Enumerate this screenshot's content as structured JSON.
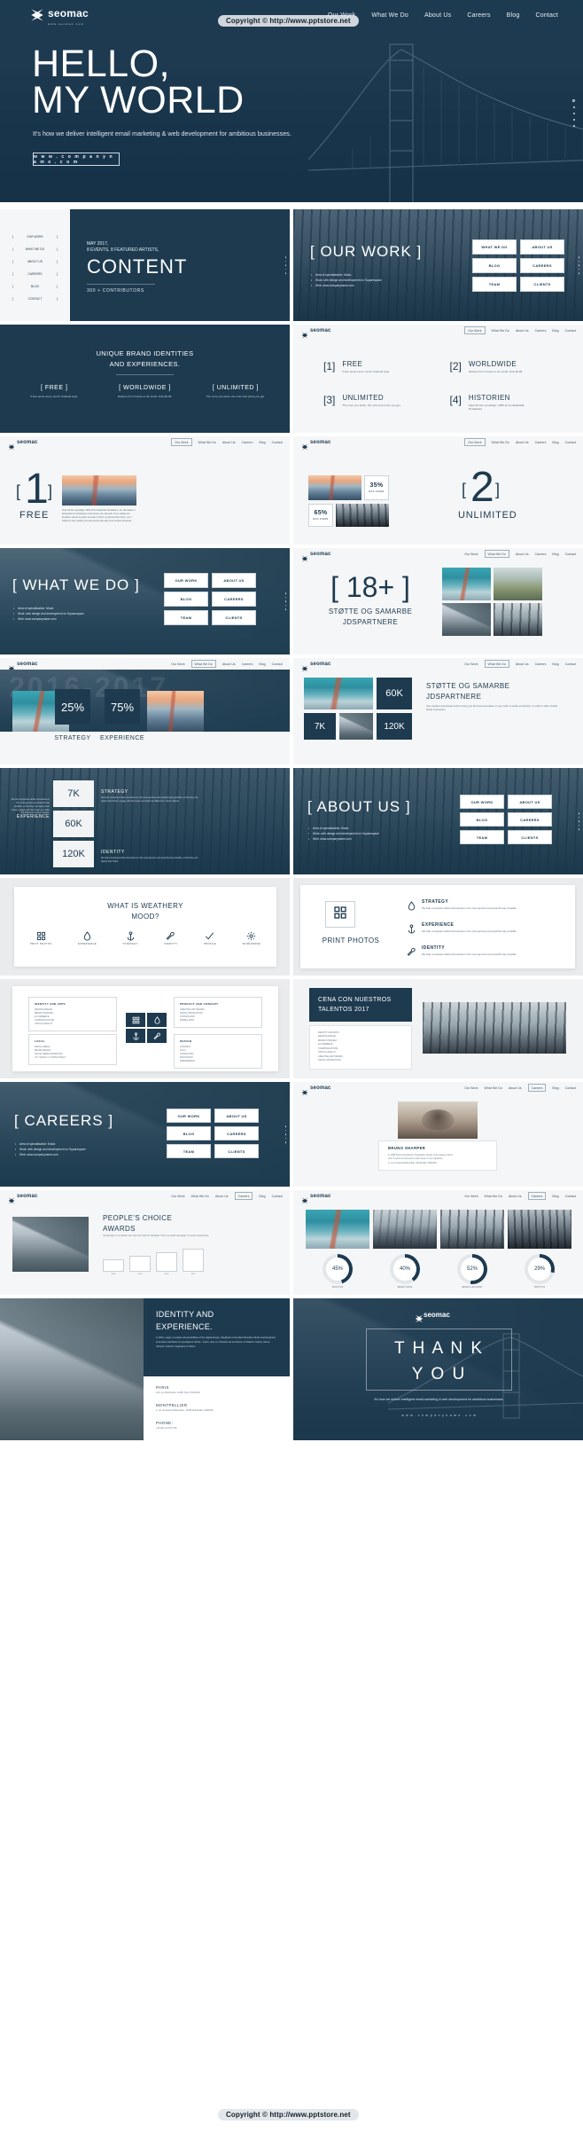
{
  "brand": {
    "name": "seomac",
    "tagline": "www.seomac.com"
  },
  "watermarks": {
    "top": "Copyright © http://www.pptstore.net",
    "bottom": "Copyright © http://www.pptstore.net"
  },
  "hero": {
    "nav": [
      "Our Work",
      "What We Do",
      "About Us",
      "Careers",
      "Blog",
      "Contact"
    ],
    "title_line1": "HELLO,",
    "title_line2": "MY WORLD",
    "subtitle": "It's how we deliver intelligent email marketing & web development for ambitious businesses.",
    "button": "w w w . c o m p a n y n a m e . c o m"
  },
  "slide_content": {
    "menu": [
      "OUR WORK",
      "WHAT WE DO",
      "ABOUT US",
      "CAREERS",
      "BLOG",
      "CONTACT"
    ],
    "eyebrow_line1": "MAY 2017,",
    "eyebrow_line2": "8 EVENTS, 8 FEATURED ARTISTS,",
    "title": "CONTENT",
    "footnote": "300 + CONTRIBUTORS"
  },
  "slide_ourwork": {
    "title": "[ OUR WORK ]",
    "bullets": [
      "Area of specialisation: Music",
      "Work: web design and development on Squarespace",
      "Web: www.companyname.com"
    ],
    "buttons": [
      "WHAT WE DO",
      "ABOUT US",
      "BLOG",
      "CAREERS",
      "TEAM",
      "CLIENTS"
    ]
  },
  "slide_brand": {
    "title_line1": "UNIQUE BRAND IDENTITIES",
    "title_line2": "AND EXPERIENCES.",
    "items": [
      {
        "label": "[     FREE     ]",
        "body": "5 free prints every month. Polaroid style."
      },
      {
        "label": "[ WORLDWIDE ]",
        "body": "Delivery from France to the world. Only $2.99."
      },
      {
        "label": "[ UNLIMITED ]",
        "body": "The more you share, the more free prints you get."
      }
    ]
  },
  "slide_numbers": {
    "nav": [
      "Our Work",
      "What We Do",
      "About Us",
      "Careers",
      "Blog",
      "Contact"
    ],
    "items": [
      {
        "num": "[1]",
        "title": "FREE",
        "body": "5 free prints every month. Polaroid style."
      },
      {
        "num": "[2]",
        "title": "WORLDWIDE",
        "body": "Delivery from France to the world. Only $2.99."
      },
      {
        "num": "[3]",
        "title": "UNLIMITED",
        "body": "The more you share, the more free prints you get."
      },
      {
        "num": "[4]",
        "title": "HISTORIEN",
        "body": "Super16 blev grundlagt i 1999 af tre idealistiske filmskabere"
      }
    ]
  },
  "slide_one": {
    "bracket_left": "[",
    "num": "1",
    "bracket_right": "]",
    "caption": "FREE",
    "body": "Super16 blev grundlagt i 1999 af tre idealistiske filmskabere, der ville skabe et fællesskab for filmskabere i København som alternativ til den etablerede filmskole. Navnet hentyder til smalle af 35mm og filmformatet 16mm, som i 1920'erne blev udviklet som økonomisk alternativ til de kostbare filmskoler."
  },
  "slide_two": {
    "bracket_left": "[",
    "num": "2",
    "bracket_right": "]",
    "caption": "UNLIMITED",
    "badges": [
      {
        "value": "35%",
        "label": "BAG FLERE"
      },
      {
        "value": "65%",
        "label": "BAG FLERE"
      }
    ]
  },
  "slide_whatwedo": {
    "title": "[ WHAT WE DO ]",
    "bullets": [
      "Area of specialisation: Music",
      "Work: web design and development on Squarespace",
      "Web: www.companyname.com"
    ],
    "buttons": [
      "OUR WORK",
      "ABOUT US",
      "BLOG",
      "CAREERS",
      "TEAM",
      "CLIENTS"
    ]
  },
  "slide_eighteen": {
    "headline": "[ 18+ ]",
    "subtitle_line1": "STØTTE OG SAMARBE",
    "subtitle_line2": "JDSPARTNERE"
  },
  "slide_percent": {
    "ghost_year": "2016-2017",
    "stats": [
      {
        "value": "25%",
        "label": "STRATEGY"
      },
      {
        "value": "75%",
        "label": "EXPERIENCE"
      }
    ]
  },
  "slide_stats_right": {
    "title_line1": "STØTTE OG SAMARBE",
    "title_line2": "JDSPARTNERE",
    "body": "Use creative and design tools to bring you the best new ideas, in your work in studio production, in order to offer it better brand impression.",
    "tiles": [
      {
        "value": "60K"
      },
      {
        "value": "7K"
      },
      {
        "value": "120K"
      }
    ]
  },
  "slide_kpi": {
    "rows": [
      {
        "value": "7K",
        "label": "STRATEGY",
        "body": "We help companies define themselves in the most genuine and powerful way possible, so that they can deploy their brand, engage with their team and make the difference in their markets."
      },
      {
        "value": "60K",
        "label": "EXPERIENCE",
        "body": "We help companies define themselves in the most genuine and powerful way possible, so that they can deploy their brand, engage with their team and make the difference in their markets."
      },
      {
        "value": "120K",
        "label": "IDENTITY",
        "body": "We help companies define themselves in the most genuine and powerful way possible, so that they can deploy their brand."
      }
    ]
  },
  "slide_about": {
    "title": "[ ABOUT US ]",
    "bullets": [
      "Area of specialisation: Music",
      "Work: web design and development on Squarespace",
      "Web: www.companyname.com"
    ],
    "buttons": [
      "OUR WORK",
      "ABOUT US",
      "BLOG",
      "CAREERS",
      "TEAM",
      "CLIENTS"
    ]
  },
  "slide_mood": {
    "title_line1": "WHAT IS WEATHERY",
    "title_line2": "MOOD?",
    "icons": [
      {
        "name": "grid-icon",
        "glyph": "grid",
        "caption": "PRINT PHOTOS"
      },
      {
        "name": "droplet-icon",
        "glyph": "drop",
        "caption": "EXPERIENCE"
      },
      {
        "name": "anchor-icon",
        "glyph": "anchor",
        "caption": "STRATEGY"
      },
      {
        "name": "wrench-icon",
        "glyph": "wrench",
        "caption": "IDENTITY"
      },
      {
        "name": "check-icon",
        "glyph": "check",
        "caption": "PROFILE"
      },
      {
        "name": "gear-icon",
        "glyph": "gear",
        "caption": "WORLDWIDE"
      }
    ]
  },
  "slide_printphotos": {
    "title": "PRINT PHOTOS",
    "items": [
      {
        "icon": "droplet-icon",
        "title": "STRATEGY",
        "body": "We help companies define themselves in the most genuine and powerful way possible."
      },
      {
        "icon": "anchor-icon",
        "title": "EXPERIENCE",
        "body": "We help companies define themselves in the most genuine and powerful way possible."
      },
      {
        "icon": "wrench-icon",
        "title": "IDENTITY",
        "body": "We help companies define themselves in the most genuine and powerful way possible."
      }
    ]
  },
  "slide_matrix": {
    "left_groups": [
      {
        "heading": "IDENTITY AND APPS",
        "items": [
          "SERVICE DESIGN",
          "BRAND STRATEGY",
          "E-COMMERCE",
          "COMMUNICATIONS",
          "VIRTUAL REALITY"
        ]
      },
      {
        "heading": "PRODUCT AND CONCEPT",
        "items": [
          "CREATIVE AND TRENDS",
          "DIGITAL PRODUCTION",
          "CONSULTANCY",
          "MOBILE APPS"
        ]
      },
      {
        "heading": "LOCAL",
        "items": [
          "DIGITAL MEDIA",
          "BRAND DESIGN",
          "SOCIAL MEDIA MARKETING",
          "UX / SOCIAL UI CONSULTANCY"
        ]
      },
      {
        "heading": "DESIGN",
        "items": [
          "STRATEGY",
          "R & D",
          "CONSULTING",
          "INNOVATION",
          "INDEPENDENT"
        ]
      }
    ],
    "center_icons": [
      "grid-icon",
      "droplet-icon",
      "anchor-icon",
      "wrench-icon"
    ]
  },
  "slide_cena": {
    "title_line1": "CENA CON NUESTROS",
    "title_line2": "TALENTOS 2017",
    "items": [
      "IDENTITY AND APPS",
      "SERVICE DESIGN",
      "BRAND STRATEGY",
      "E-COMMERCE",
      "COMMUNICATIONS",
      "VIRTUAL REALITY",
      "CREATIVE AND TRENDS",
      "DIGITAL PRODUCTION",
      "CONSULTANCY",
      "MOBILE APPS"
    ]
  },
  "slide_careers": {
    "title": "[ CAREERS ]",
    "bullets": [
      "Area of specialisation: Music",
      "Work: web design and development on Squarespace",
      "Web: www.companyname.com"
    ],
    "buttons": [
      "OUR WORK",
      "ABOUT US",
      "BLOG",
      "CAREERS",
      "TEAM",
      "CLIENTS"
    ]
  },
  "slide_profile": {
    "name": "BRUNO SHARPER",
    "lines": [
      "In 1998, Bruno founded the Typography Faculty at the design school.",
      "Over 8 years he pioneered a wide range of new typefaces.",
      "1; rue du Général Maurelhan, Montpellier, FRANCE"
    ]
  },
  "slide_awards": {
    "title_line1": "PEOPLE'S CHOICE",
    "title_line2": "AWARDS",
    "body": "Consectetur ut at dolore sed. Use the tools for standard. This is a social campaign to recruit researchers.",
    "bars": [
      {
        "label": "2014"
      },
      {
        "label": "2015"
      },
      {
        "label": "2016"
      },
      {
        "label": "2017"
      }
    ]
  },
  "slide_donuts": {
    "items": [
      {
        "value": "45%",
        "label": "PRINT PCS"
      },
      {
        "value": "40%",
        "label": "BRAND SHAPE"
      },
      {
        "value": "52%",
        "label": "DESIGN & ECONOMY"
      },
      {
        "value": "29%",
        "label": "PRINT PCS"
      }
    ]
  },
  "slide_identity": {
    "title_line1": "IDENTITY AND",
    "title_line2": "EXPERIENCE.",
    "body": "In 2001, eager to explore all possibilities of the digital design, Siegfried co-founded Panoplie Studio and designed innovative interfaces for prestigious clients : Gucci, Jeio, le ministère de la Culture, le Palazzo Grassi, Veuve Clicquot, Ubisoft, Lagardère or Rolex.",
    "contacts": [
      {
        "label": "PARIS",
        "value": "123, rue Montmartre,  11165,  Paris,  FRANCE"
      },
      {
        "label": "MONTPELLIER",
        "value": "1, rue du Général Maurelhan,  12345 Montpellier,  FRANCE"
      },
      {
        "label": "PHONE:",
        "value": "+33 (0)1 23 45 67 89"
      }
    ]
  },
  "slide_thanks": {
    "line1": "T H A N K",
    "line2": "Y O U",
    "subtitle": "It's how we deliver intelligent email marketing & web development for ambitious businesses.",
    "url": "w w w . c o m p a n y n a m e . c o m"
  }
}
